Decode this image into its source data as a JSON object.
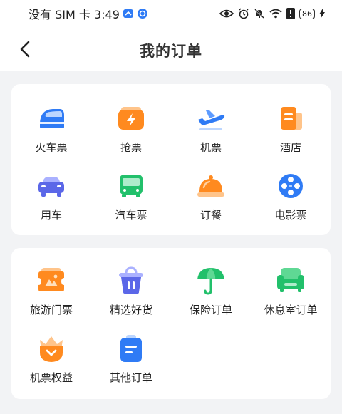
{
  "status_bar": {
    "time_text": "没有 SIM 卡 3:49",
    "battery": "86"
  },
  "header": {
    "title": "我的订单"
  },
  "section1": [
    {
      "label": "火车票",
      "icon": "train-icon"
    },
    {
      "label": "抢票",
      "icon": "flash-ticket-icon"
    },
    {
      "label": "机票",
      "icon": "plane-icon"
    },
    {
      "label": "酒店",
      "icon": "hotel-icon"
    },
    {
      "label": "用车",
      "icon": "car-icon"
    },
    {
      "label": "汽车票",
      "icon": "bus-icon"
    },
    {
      "label": "订餐",
      "icon": "dining-cloche-icon"
    },
    {
      "label": "电影票",
      "icon": "film-reel-icon"
    }
  ],
  "section2": [
    {
      "label": "旅游门票",
      "icon": "scenic-ticket-icon"
    },
    {
      "label": "精选好货",
      "icon": "shopping-basket-icon"
    },
    {
      "label": "保险订单",
      "icon": "umbrella-icon"
    },
    {
      "label": "休息室订单",
      "icon": "lounge-sofa-icon"
    },
    {
      "label": "机票权益",
      "icon": "crown-badge-icon"
    },
    {
      "label": "其他订单",
      "icon": "clipboard-icon"
    }
  ],
  "colors": {
    "orange": "#ff8a1f",
    "blue": "#2f7bf5",
    "green": "#22c06b",
    "purple": "#5b67e8"
  }
}
